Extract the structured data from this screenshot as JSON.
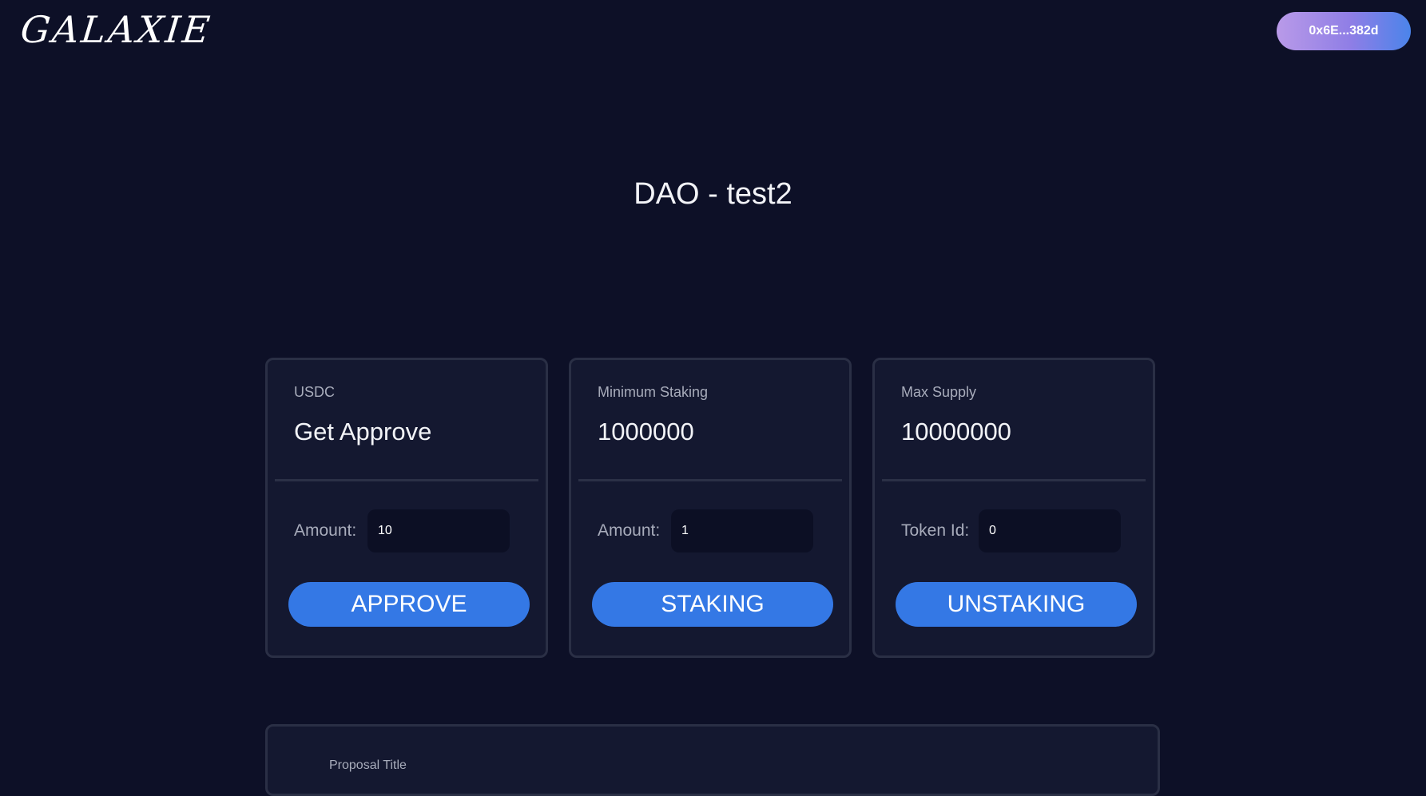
{
  "header": {
    "logo_text": "GALAXIE",
    "wallet_address": "0x6E...382d"
  },
  "page_title": "DAO - test2",
  "cards": [
    {
      "label": "USDC",
      "value": "Get Approve",
      "field_label": "Amount:",
      "field_value": "10",
      "button_label": "APPROVE"
    },
    {
      "label": "Minimum Staking",
      "value": "1000000",
      "field_label": "Amount:",
      "field_value": "1",
      "button_label": "STAKING"
    },
    {
      "label": "Max Supply",
      "value": "10000000",
      "field_label": "Token Id:",
      "field_value": "0",
      "button_label": "UNSTAKING"
    }
  ],
  "proposal": {
    "title_label": "Proposal Title"
  },
  "colors": {
    "background": "#0d1027",
    "card_background": "#141830",
    "accent_button": "#3478e5",
    "wallet_gradient_start": "#b99ae8",
    "wallet_gradient_end": "#4b84ea"
  }
}
